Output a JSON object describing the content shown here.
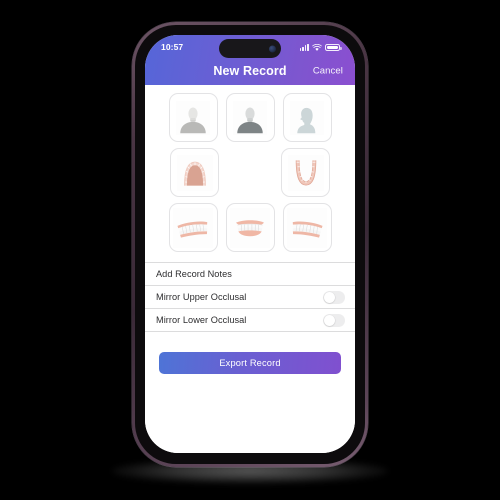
{
  "device": {
    "name": "iphone-mockup",
    "frame_color": "#4a3544",
    "bezel_color": "#0d0b0d"
  },
  "status_bar": {
    "time": "10:57",
    "signal_icon": "cellular-signal-icon",
    "wifi_icon": "wifi-icon",
    "battery_icon": "battery-icon"
  },
  "header": {
    "title": "New Record",
    "cancel_label": "Cancel",
    "gradient_from": "#5566d8",
    "gradient_to": "#8b4fd0"
  },
  "grid": {
    "rows": [
      {
        "name": "extraoral-photos-row",
        "tiles": [
          {
            "name": "face-frontal-rest-tile",
            "icon": "face-frontal-icon",
            "alt": "Face frontal at rest"
          },
          {
            "name": "face-frontal-smile-tile",
            "icon": "face-frontal-dark-icon",
            "alt": "Face frontal smiling"
          },
          {
            "name": "face-profile-tile",
            "icon": "face-profile-icon",
            "alt": "Face profile"
          }
        ]
      },
      {
        "name": "occlusal-photos-row",
        "tiles": [
          {
            "name": "upper-occlusal-tile",
            "icon": "upper-occlusal-arch-icon",
            "alt": "Upper occlusal"
          },
          {
            "name": "lower-occlusal-tile",
            "icon": "lower-occlusal-arch-icon",
            "alt": "Lower occlusal"
          }
        ]
      },
      {
        "name": "intraoral-photos-row",
        "tiles": [
          {
            "name": "right-buccal-tile",
            "icon": "teeth-right-buccal-icon",
            "alt": "Right buccal"
          },
          {
            "name": "frontal-bite-tile",
            "icon": "teeth-frontal-icon",
            "alt": "Frontal bite"
          },
          {
            "name": "left-buccal-tile",
            "icon": "teeth-left-buccal-icon",
            "alt": "Left buccal"
          }
        ]
      }
    ]
  },
  "list": {
    "rows": [
      {
        "name": "add-record-notes-row",
        "label": "Add Record Notes",
        "type": "navigation"
      },
      {
        "name": "mirror-upper-occlusal-row",
        "label": "Mirror Upper Occlusal",
        "type": "toggle",
        "value": "off"
      },
      {
        "name": "mirror-lower-occlusal-row",
        "label": "Mirror Lower Occlusal",
        "type": "toggle",
        "value": "off"
      }
    ]
  },
  "footer": {
    "export_label": "Export Record",
    "export_gradient_from": "#4e74d6",
    "export_gradient_to": "#8050cf"
  }
}
